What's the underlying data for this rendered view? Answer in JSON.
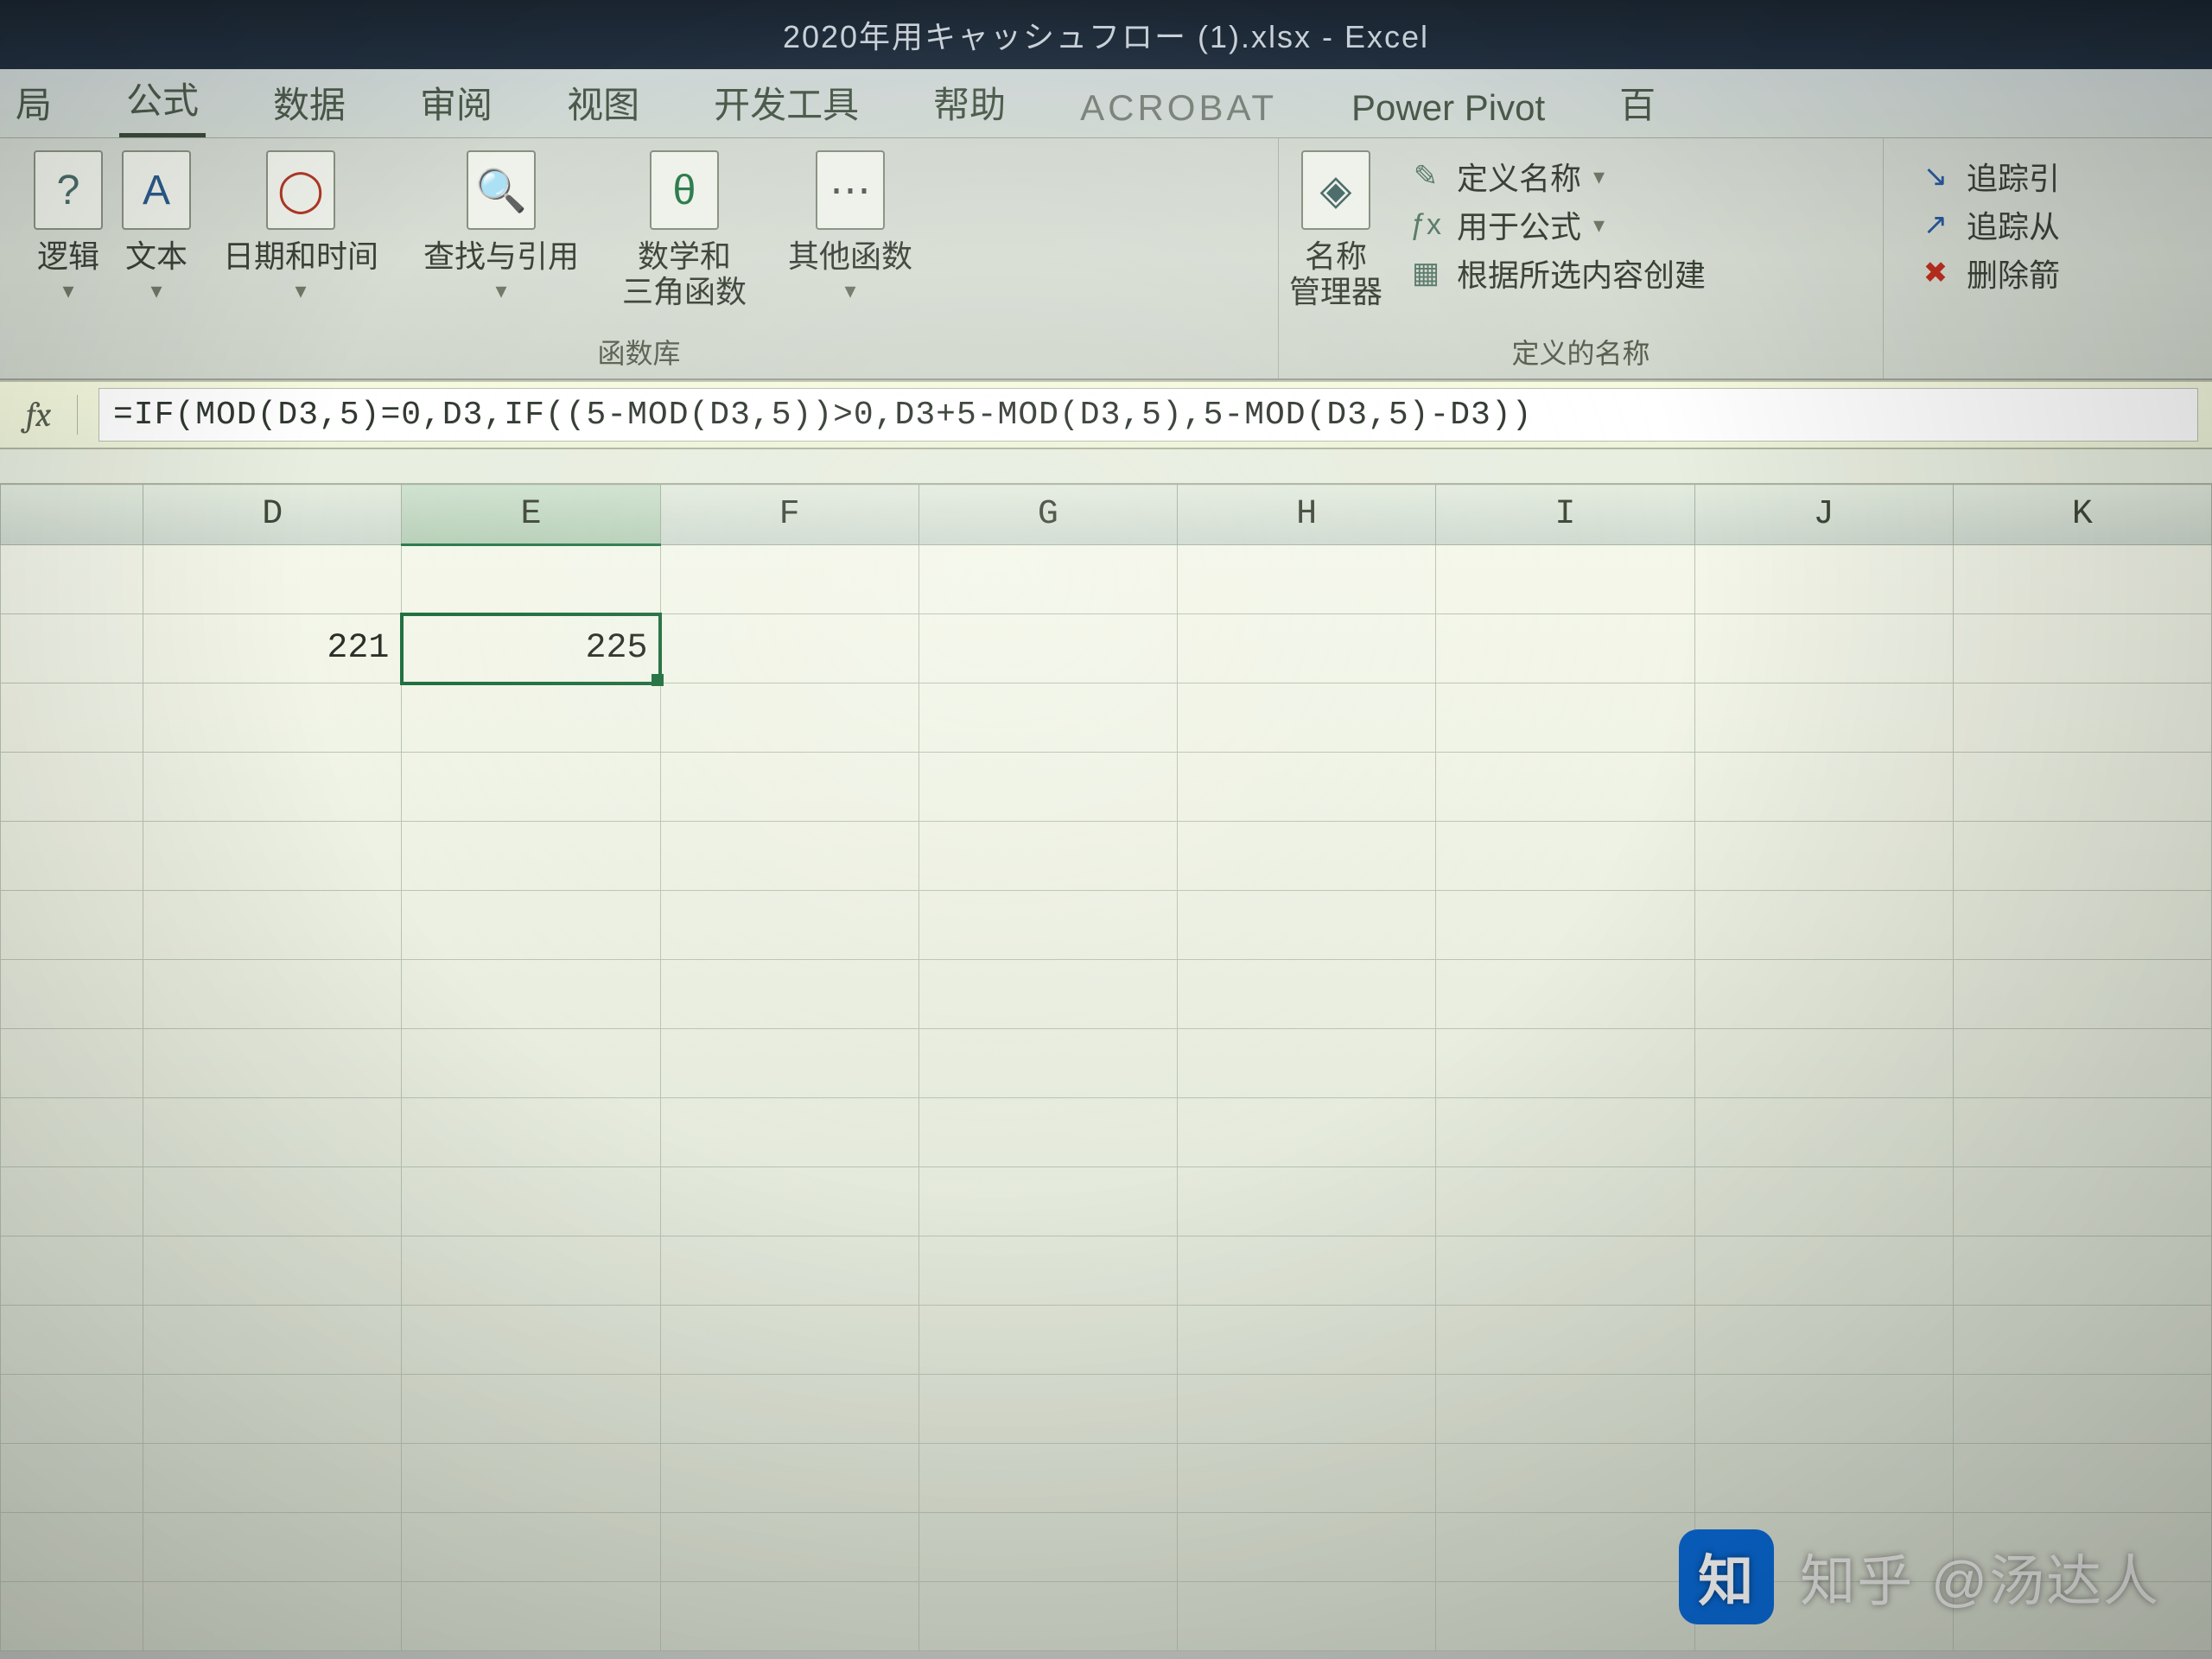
{
  "titlebar": {
    "text": "2020年用キャッシュフロー (1).xlsx  -  Excel"
  },
  "tabs": {
    "t0": "局",
    "t1": "公式",
    "t2": "数据",
    "t3": "审阅",
    "t4": "视图",
    "t5": "开发工具",
    "t6": "帮助",
    "t7": "ACROBAT",
    "t8": "Power Pivot",
    "t9": "百"
  },
  "ribbon": {
    "funclib_label": "函数库",
    "btns": {
      "recent": {
        "icon": "?",
        "label": "逻辑"
      },
      "text": {
        "icon": "A",
        "label": "文本"
      },
      "date": {
        "icon": "◯",
        "label": "日期和时间"
      },
      "lookup": {
        "icon": "🔍",
        "label": "查找与引用"
      },
      "math": {
        "icon": "θ",
        "label": "数学和\n三角函数"
      },
      "more": {
        "icon": "⋯",
        "label": "其他函数"
      },
      "names": {
        "icon": "◈",
        "label": "名称\n管理器"
      }
    },
    "names_group_label": "定义的名称",
    "name_items": {
      "define": "定义名称",
      "usein": "用于公式",
      "create": "根据所选内容创建"
    },
    "audit": {
      "trace_prec": "追踪引",
      "trace_dep": "追踪从",
      "remove": "删除箭"
    }
  },
  "formula_bar": {
    "fx": "fx",
    "value": "=IF(MOD(D3,5)=0,D3,IF((5-MOD(D3,5))>0,D3+5-MOD(D3,5),5-MOD(D3,5)-D3))"
  },
  "grid": {
    "columns": [
      "D",
      "E",
      "F",
      "G",
      "H",
      "I",
      "J",
      "K"
    ],
    "selected_col": "E",
    "cells": {
      "D3": "221",
      "E3": "225"
    }
  },
  "watermark": {
    "logo": "知",
    "text": "知乎 @汤达人"
  }
}
